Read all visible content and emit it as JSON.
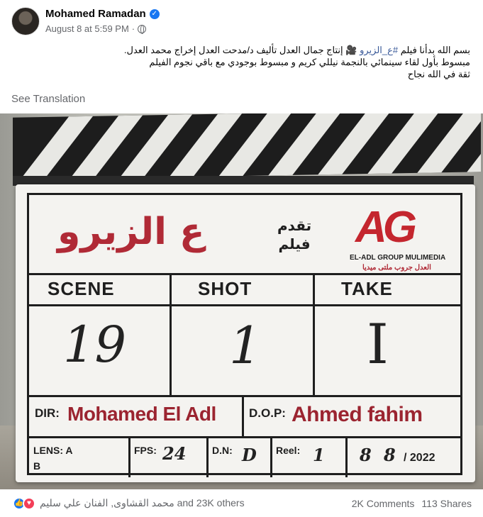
{
  "post": {
    "author": "Mohamed Ramadan",
    "timestamp": "August 8 at 5:59 PM",
    "audience_icon": "globe-icon",
    "verified_icon": "verified-badge-icon",
    "text_line1_before": "بسم الله بدأنا فيلم ",
    "hashtag": "#ع_الزيرو",
    "text_line1_after": " 🎥 إنتاج جمال العدل تأليف د/مدحت العدل إخراج محمد العدل.",
    "text_line2": "مبسوط بأول لقاء سينمائي بالنجمة نيللي كريم و مبسوط بوجودي مع باقي نجوم الفيلم",
    "text_line3": "ثقة في الله نجاح",
    "see_translation": "See Translation"
  },
  "clapperboard": {
    "film_title": "ع الزيرو",
    "presents_line1": "تقدم",
    "presents_line2": "فيلم",
    "logo_mark": "AG",
    "logo_sub_en": "EL-ADL GROUP MULIMEDIA",
    "logo_sub_ar": "العدل جروب ملتى ميديا",
    "scene_label": "SCENE",
    "shot_label": "SHOT",
    "take_label": "TAKE",
    "scene_value": "19",
    "shot_value": "1",
    "take_value": "I",
    "dir_label": "DIR:",
    "dir_value": "Mohamed El Adl",
    "dop_label": "D.O.P:",
    "dop_value": "Ahmed fahim",
    "lens_label": "LENS: A",
    "lens_b": "B",
    "fps_label": "FPS:",
    "fps_value": "24",
    "dn_label": "D.N:",
    "dn_value": "D",
    "reel_label": "Reel:",
    "reel_value": "1",
    "date_value_day": "8",
    "date_value_month": "8",
    "date_value_year": "/ 2022"
  },
  "footer": {
    "reactions_text": "محمد القشاوى, الفنان علي سليم and 23K others",
    "comments": "2K Comments",
    "shares": "113 Shares"
  },
  "colors": {
    "accent": "#1877f2",
    "brand_red": "#c4262e",
    "hashtag": "#385898"
  }
}
